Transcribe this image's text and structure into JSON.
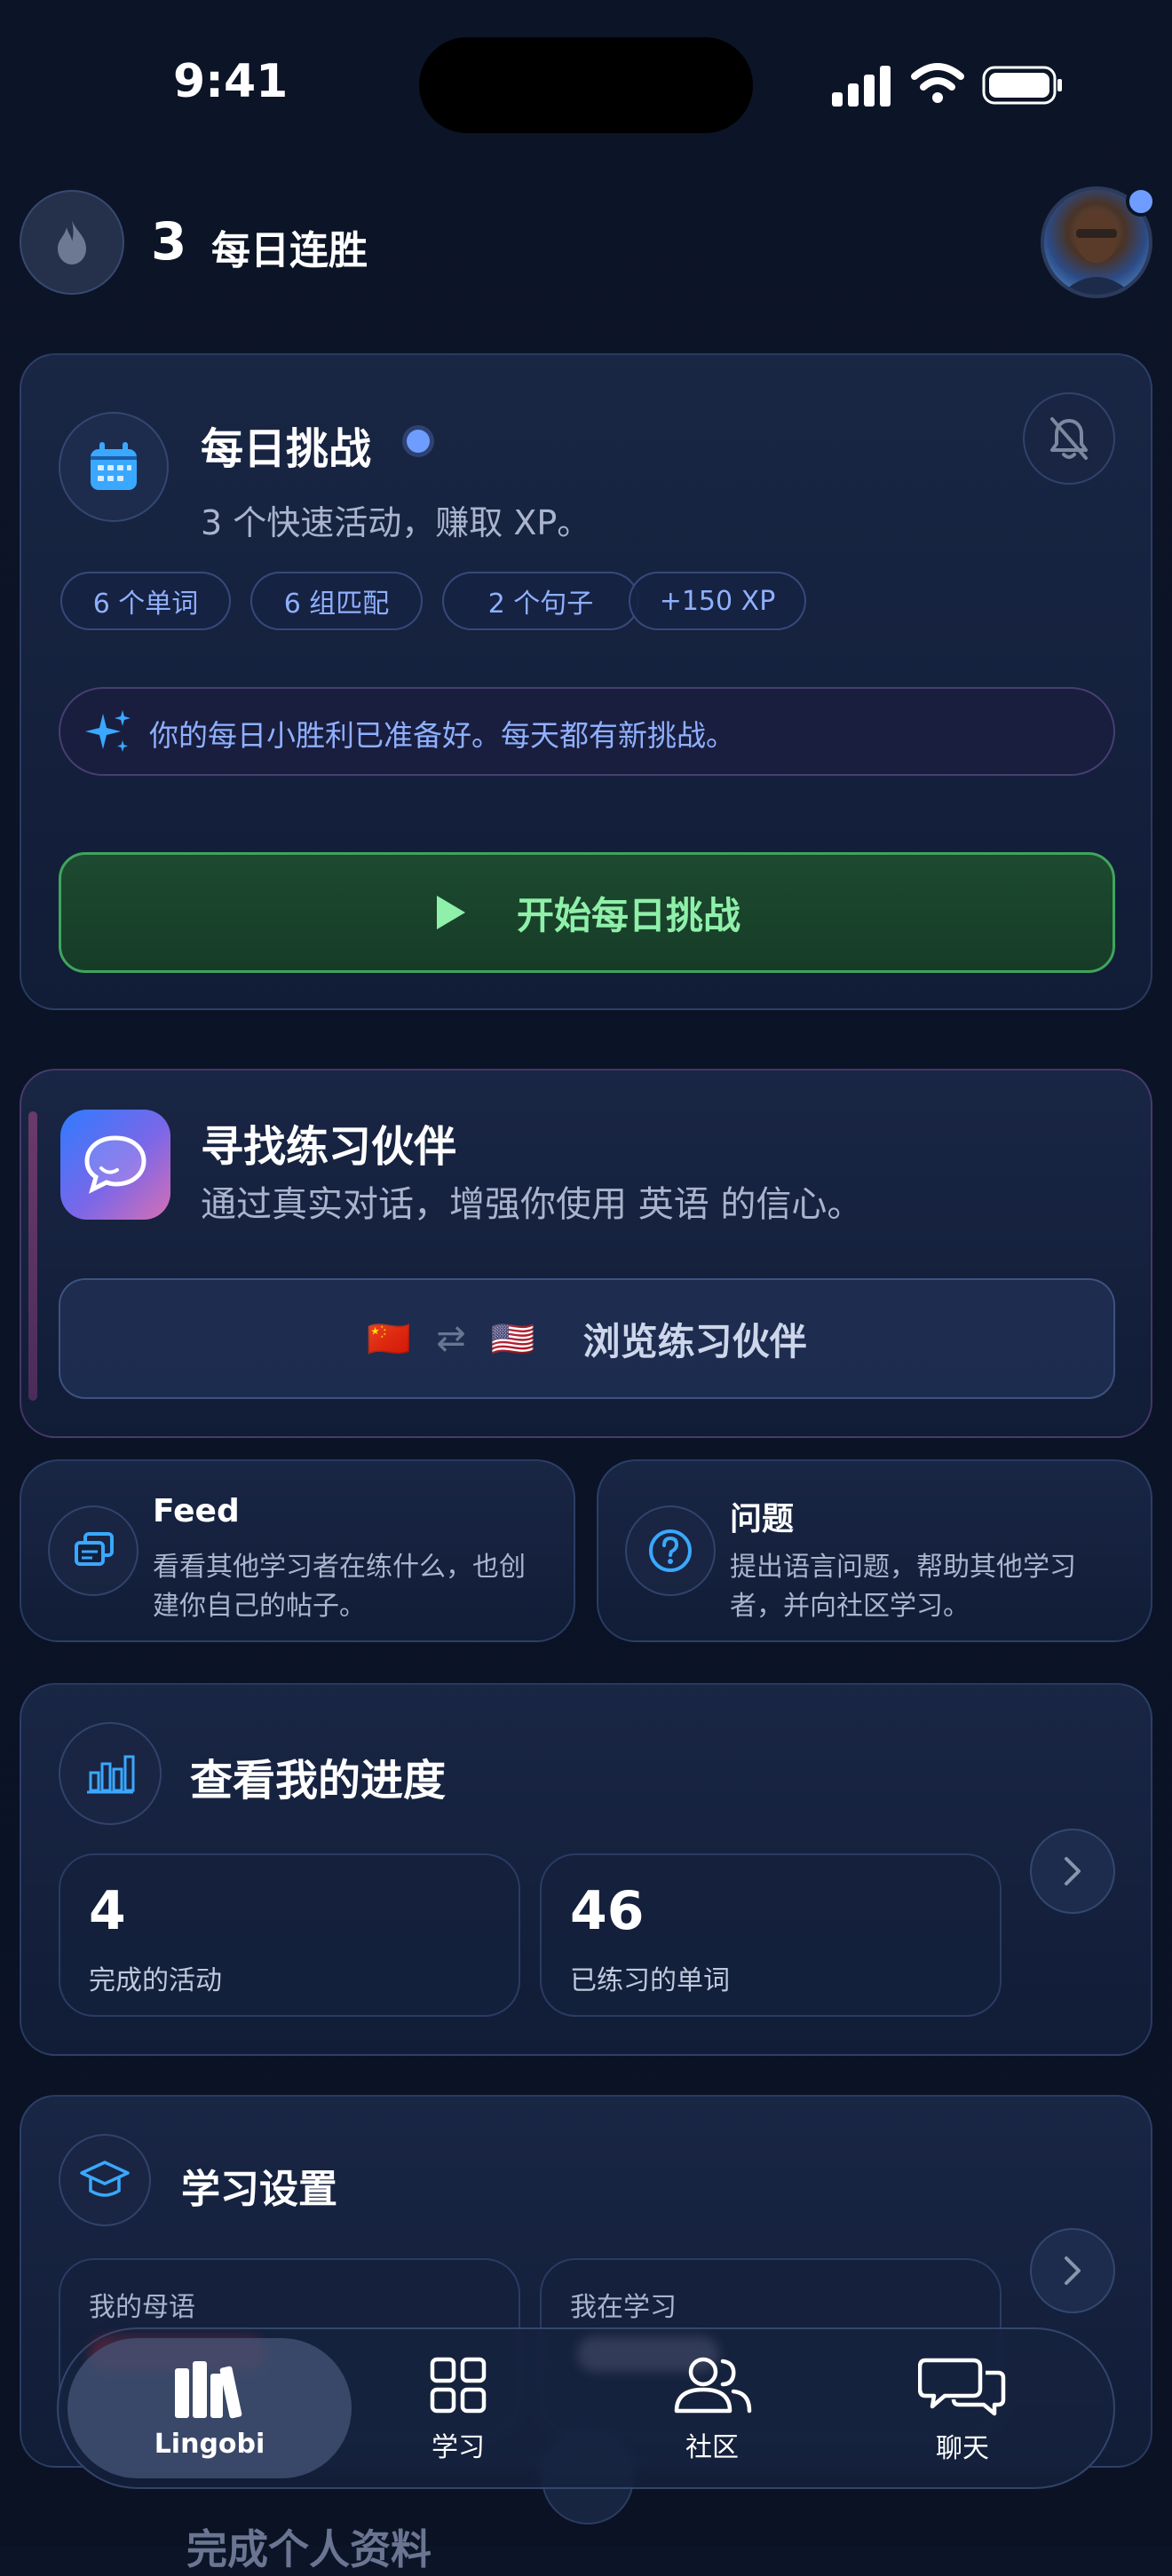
{
  "status_bar": {
    "time": "9:41"
  },
  "header": {
    "streak_count": "3",
    "streak_label": "每日连胜"
  },
  "daily_challenge": {
    "title": "每日挑战",
    "subtitle": "3 个快速活动，赚取 XP。",
    "chips": [
      "6 个单词",
      "6 组匹配",
      "2 个句子",
      "+150 XP"
    ],
    "tip": "你的每日小胜利已准备好。每天都有新挑战。",
    "start_button": "开始每日挑战"
  },
  "partner": {
    "title": "寻找练习伙伴",
    "subtitle": "通过真实对话，增强你使用 英语 的信心。",
    "browse_button": "浏览练习伙伴",
    "flag_from": "🇨🇳",
    "flag_to": "🇺🇸",
    "swap_symbol": "⇄"
  },
  "feed": {
    "title": "Feed",
    "desc_line1": "看看其他学习者在练什么，也创",
    "desc_line2": "建你自己的帖子。"
  },
  "questions": {
    "title": "问题",
    "desc_line1": "提出语言问题，帮助其他学习",
    "desc_line2": "者，并向社区学习。"
  },
  "progress": {
    "title": "查看我的进度",
    "stats": [
      {
        "value": "4",
        "label": "完成的活动"
      },
      {
        "value": "46",
        "label": "已练习的单词"
      }
    ]
  },
  "settings": {
    "title": "学习设置",
    "native_label": "我的母语",
    "learning_label": "我在学习",
    "learning_value": "英语"
  },
  "partial_card": {
    "title": "完成个人资料"
  },
  "tab_bar": {
    "items": [
      {
        "label": "Lingobi",
        "icon": "library-icon"
      },
      {
        "label": "学习",
        "icon": "grid-icon"
      },
      {
        "label": "社区",
        "icon": "people-icon"
      },
      {
        "label": "聊天",
        "icon": "chat-bubbles-icon"
      }
    ]
  },
  "colors": {
    "accent_blue": "#3aa8ff",
    "start_green": "#8ff0a9",
    "chip_text": "#8fb0ff",
    "status_dot": "#6f9dff"
  }
}
